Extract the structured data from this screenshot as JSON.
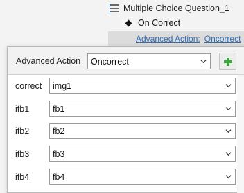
{
  "tree": {
    "question_label": "Multiple Choice Question_1",
    "event_label": "On Correct",
    "action_prefix": "Advanced Action:",
    "action_value": "Oncorrect"
  },
  "popup": {
    "advanced_action_label": "Advanced Action",
    "advanced_action_value": "Oncorrect",
    "params": [
      {
        "name": "correct",
        "value": "img1"
      },
      {
        "name": "ifb1",
        "value": "fb1"
      },
      {
        "name": "ifb2",
        "value": "fb2"
      },
      {
        "name": "ifb3",
        "value": "fb3"
      },
      {
        "name": "ifb4",
        "value": "fb4"
      }
    ]
  },
  "colors": {
    "link": "#2f6db5",
    "add_icon": "#3aa53a"
  },
  "icons": {
    "question": "list-icon",
    "event": "diamond-icon",
    "dropdown": "chevron-down-icon",
    "add": "plus-icon"
  }
}
